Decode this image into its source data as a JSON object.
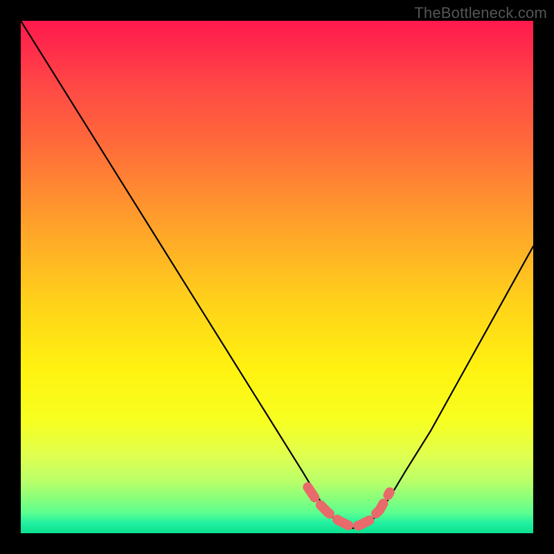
{
  "watermark": "TheBottleneck.com",
  "chart_data": {
    "type": "line",
    "title": "",
    "xlabel": "",
    "ylabel": "",
    "xlim": [
      0,
      100
    ],
    "ylim": [
      0,
      100
    ],
    "curve": {
      "name": "bottleneck-curve",
      "x": [
        0,
        5,
        10,
        15,
        20,
        25,
        30,
        35,
        40,
        45,
        50,
        55,
        58,
        60,
        62,
        64,
        66,
        68,
        70,
        72,
        75,
        80,
        85,
        90,
        95,
        100
      ],
      "y": [
        100,
        92,
        84,
        76,
        68,
        60,
        52,
        44,
        36,
        28,
        20,
        12,
        7,
        4,
        2,
        1,
        1,
        2,
        4,
        7,
        12,
        20,
        29,
        38,
        47,
        56
      ]
    },
    "highlight_segment": {
      "name": "optimal-range",
      "color": "#e86a6a",
      "x": [
        56,
        58,
        60,
        62,
        64,
        66,
        68,
        70,
        72
      ],
      "y": [
        9,
        6,
        4,
        2.5,
        1.5,
        1.5,
        2.5,
        4.5,
        8
      ]
    },
    "gradient_stops": [
      {
        "pos": 0,
        "color": "#ff1a4d"
      },
      {
        "pos": 24,
        "color": "#ff6a3a"
      },
      {
        "pos": 55,
        "color": "#ffd21a"
      },
      {
        "pos": 78,
        "color": "#f7ff20"
      },
      {
        "pos": 93,
        "color": "#8cff7a"
      },
      {
        "pos": 100,
        "color": "#0be090"
      }
    ]
  }
}
